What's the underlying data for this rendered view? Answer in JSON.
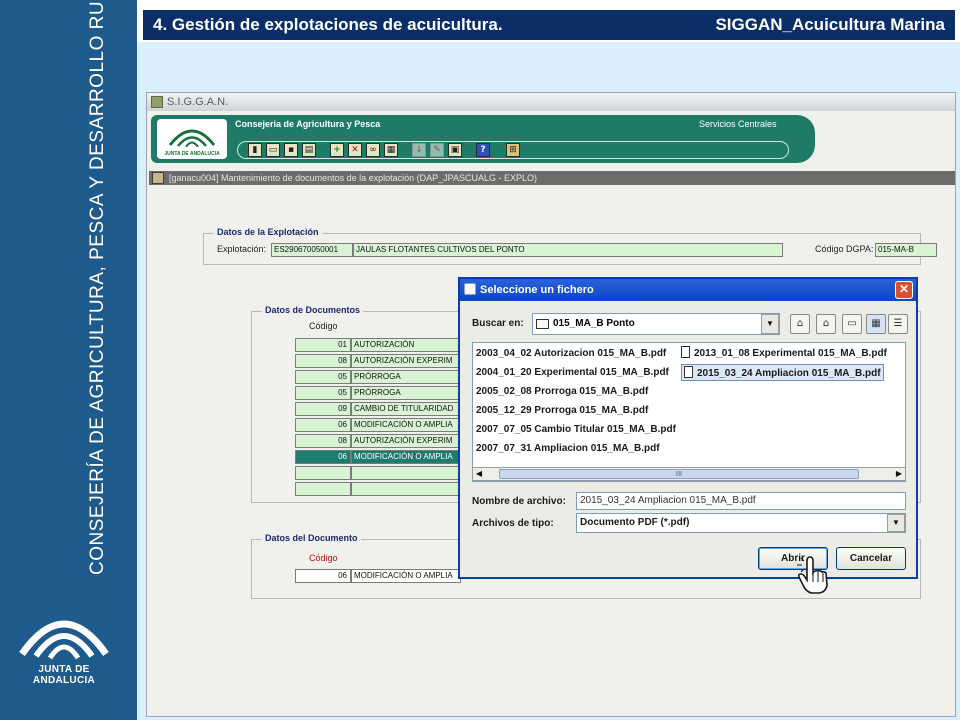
{
  "slide": {
    "title_left": "4. Gestión de explotaciones de acuicultura.",
    "title_right": "SIGGAN_Acuicultura Marina",
    "vertical_text": "CONSEJERÍA DE AGRICULTURA, PESCA Y DESARROLLO RURAL",
    "logo_text": "JUNTA DE ANDALUCIA",
    "colors": {
      "left_panel": "#1e5a8c",
      "title_bar": "#0b2e68",
      "background": "#dbeefb"
    }
  },
  "app": {
    "window_title": "S.I.G.G.A.N.",
    "banner": {
      "org": "Consejeria de Agricultura y Pesca",
      "services": "Servicios Centrales",
      "logo_text": "JUNTA DE ANDALUCIA"
    },
    "toolbar_icons": [
      "exit-icon",
      "open-folder-icon",
      "save-icon",
      "print-icon",
      "add-icon",
      "delete-icon",
      "search-binoculars-icon",
      "report-icon",
      "down-arrow-icon",
      "edit-icon",
      "calendar-icon",
      "help-icon",
      "tree-icon"
    ],
    "help_glyph": "?",
    "subwindow_title": "[ganacu004] Mantenimiento de documentos de la explotación   (DAP_JPASCUALG - EXPLO)",
    "explotacion": {
      "group_title": "Datos de la Explotación",
      "label": "Explotación:",
      "code": "ES290670050001",
      "name": "JAULAS FLOTANTES CULTIVOS DEL PONTO",
      "dgpa_label": "Código DGPA:",
      "dgpa_value": "015-MA-B"
    },
    "documentos": {
      "group_title": "Datos de Documentos",
      "col_codigo": "Código",
      "rows": [
        {
          "code": "01",
          "desc": "AUTORIZACIÓN"
        },
        {
          "code": "08",
          "desc": "AUTORIZACIÓN EXPERIM"
        },
        {
          "code": "05",
          "desc": "PRÓRROGA"
        },
        {
          "code": "05",
          "desc": "PRÓRROGA"
        },
        {
          "code": "09",
          "desc": "CAMBIO DE TITULARIDAD"
        },
        {
          "code": "06",
          "desc": "MODIFICACIÓN O AMPLIA"
        },
        {
          "code": "08",
          "desc": "AUTORIZACIÓN EXPERIM"
        },
        {
          "code": "06",
          "desc": "MODIFICACIÓN O AMPLIA"
        },
        {
          "code": "",
          "desc": ""
        },
        {
          "code": "",
          "desc": ""
        }
      ],
      "selected_row": 7
    },
    "documento": {
      "group_title": "Datos del Documento",
      "col_codigo": "Código",
      "code": "06",
      "desc": "MODIFICACIÓN O AMPLIA"
    }
  },
  "dialog": {
    "title": "Seleccione un fichero",
    "close_glyph": "✕",
    "lookin_label": "Buscar en:",
    "lookin_value": "015_MA_B Ponto",
    "files_col1": [
      "2003_04_02 Autorizacion 015_MA_B.pdf",
      "2004_01_20 Experimental 015_MA_B.pdf",
      "2005_02_08 Prorroga 015_MA_B.pdf",
      "2005_12_29 Prorroga 015_MA_B.pdf",
      "2007_07_05 Cambio Titular 015_MA_B.pdf",
      "2007_07_31 Ampliacion 015_MA_B.pdf"
    ],
    "files_col2": [
      "2013_01_08 Experimental 015_MA_B.pdf",
      "2015_03_24 Ampliacion 015_MA_B.pdf"
    ],
    "selected_file": "2015_03_24 Ampliacion 015_MA_B.pdf",
    "scroll_thumb_mark": "III",
    "filename_label": "Nombre de archivo:",
    "filename_value": "2015_03_24 Ampliacion 015_MA_B.pdf",
    "filetype_label": "Archivos de tipo:",
    "filetype_value": "Documento PDF (*.pdf)",
    "open_button": "Abrir",
    "cancel_button": "Cancelar"
  }
}
